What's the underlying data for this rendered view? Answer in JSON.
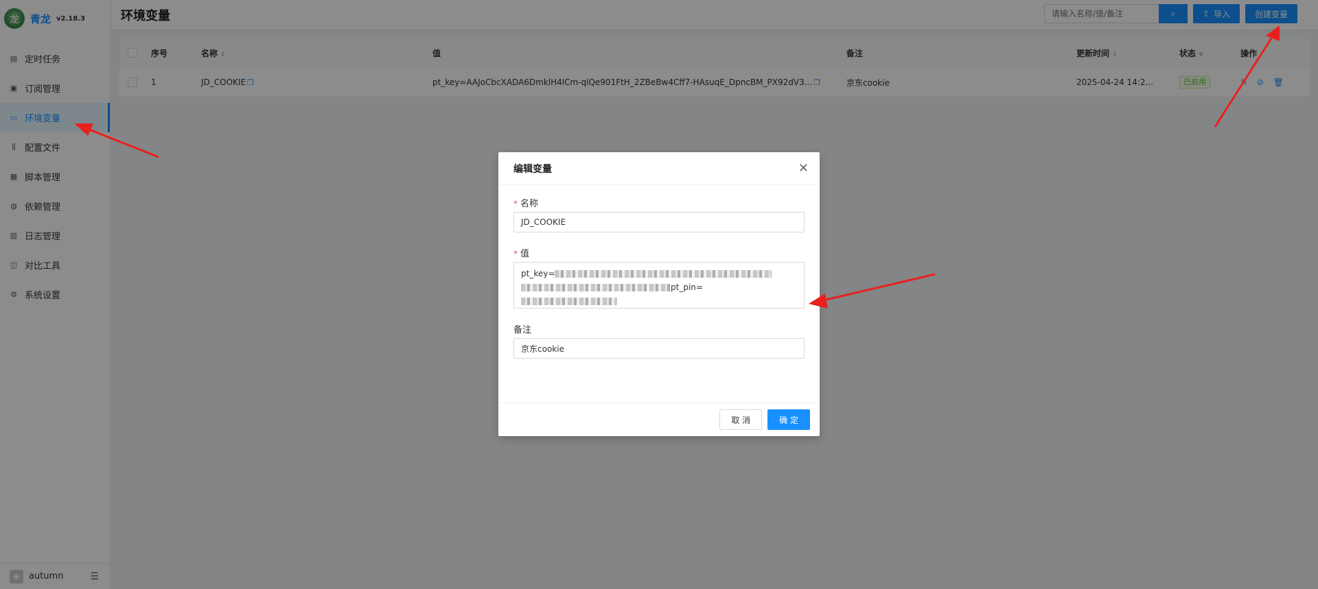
{
  "app": {
    "name": "青龙",
    "version": "v2.18.3",
    "logo_icon": "dragon-logo"
  },
  "sidebar": {
    "items": [
      {
        "label": "定时任务",
        "icon": "clock-icon",
        "glyph": "▤"
      },
      {
        "label": "订阅管理",
        "icon": "subscribe-icon",
        "glyph": "▣"
      },
      {
        "label": "环境变量",
        "icon": "monitor-icon",
        "glyph": "▭",
        "active": true
      },
      {
        "label": "配置文件",
        "icon": "sliders-icon",
        "glyph": "⫼"
      },
      {
        "label": "脚本管理",
        "icon": "script-icon",
        "glyph": "▦"
      },
      {
        "label": "依赖管理",
        "icon": "package-icon",
        "glyph": "◍"
      },
      {
        "label": "日志管理",
        "icon": "log-icon",
        "glyph": "▥"
      },
      {
        "label": "对比工具",
        "icon": "diff-icon",
        "glyph": "◫"
      },
      {
        "label": "系统设置",
        "icon": "gear-icon",
        "glyph": "⚙"
      }
    ],
    "user": "autumn"
  },
  "header": {
    "title": "环境变量",
    "search_placeholder": "请输入名称/值/备注",
    "import_label": "导入",
    "create_label": "创建变量"
  },
  "table": {
    "columns": {
      "index": "序号",
      "name": "名称",
      "value": "值",
      "remark": "备注",
      "updated": "更新时间",
      "status": "状态",
      "actions": "操作"
    },
    "rows": [
      {
        "index": "1",
        "name": "JD_COOKIE",
        "value": "pt_key=AAJoCbcXADA6DmklH4lCm-qlQe901FtH_2ZBeBw4Cff7-HAsuqE_DpncBM_PX92dV3...",
        "remark": "京东cookie",
        "updated": "2025-04-24 14:2...",
        "status": "已启用"
      }
    ]
  },
  "modal": {
    "title": "编辑变量",
    "name_label": "名称",
    "name_value": "JD_COOKIE",
    "value_label": "值",
    "value_prefix": "pt_key=",
    "value_mid": "pt_pin=",
    "remark_label": "备注",
    "remark_value": "京东cookie",
    "cancel_label": "取 消",
    "ok_label": "确 定"
  },
  "colors": {
    "primary": "#1890ff",
    "annotation_arrow": "#e8211f",
    "success": "#52c41a"
  }
}
